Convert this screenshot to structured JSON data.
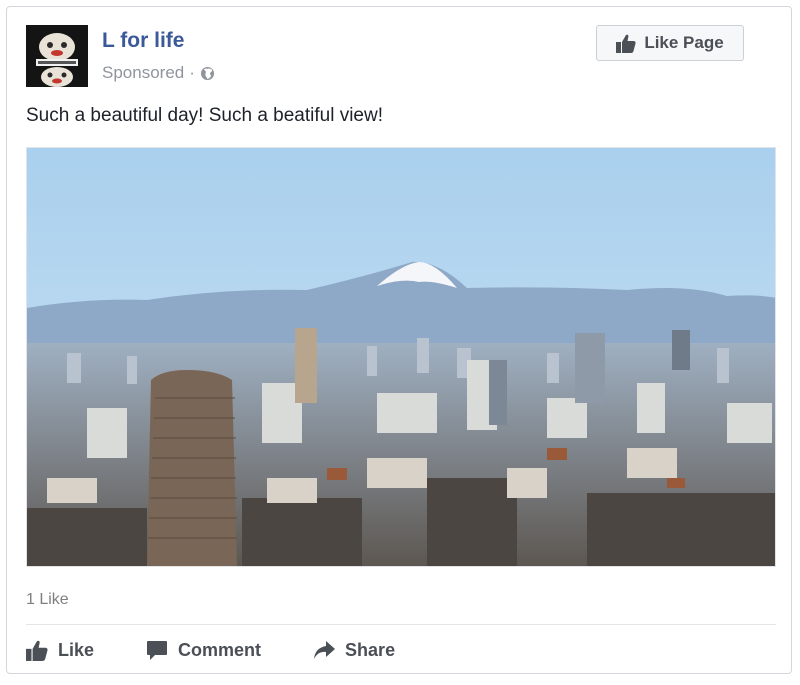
{
  "post": {
    "page_name": "L for life",
    "sponsored": "Sponsored",
    "separator": "·",
    "text": "Such a beautiful day! Such a beatiful view!",
    "like_page_label": "Like Page",
    "likes_count": "1 Like"
  },
  "actions": {
    "like": "Like",
    "comment": "Comment",
    "share": "Share"
  },
  "icons": {
    "globe": "globe-icon",
    "thumbs_up": "thumbs-up-icon",
    "comment": "comment-icon",
    "share": "share-arrow-icon"
  },
  "colors": {
    "page_name": "#3b5998",
    "meta_text": "#90949c",
    "action_text": "#4b4f56",
    "sky": "#b9d8f0",
    "mountains": "#8faacb"
  }
}
